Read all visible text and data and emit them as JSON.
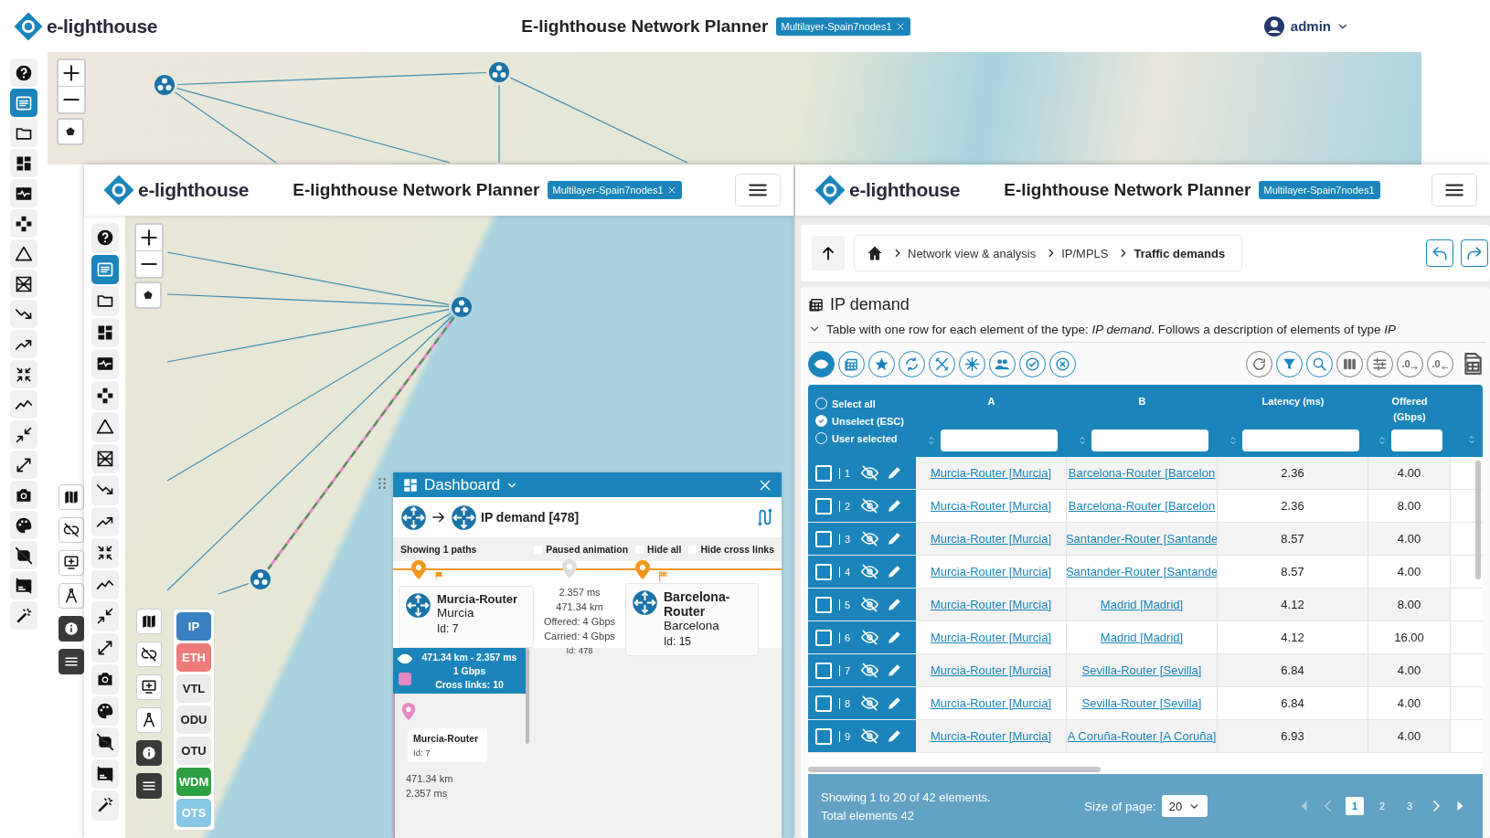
{
  "app_header": {
    "logo": "e-lighthouse",
    "title": "E-lighthouse Network Planner",
    "design_tag": "Multilayer-Spain7nodes1",
    "user": "admin"
  },
  "left_window": {
    "logo": "e-lighthouse",
    "title": "E-lighthouse Network Planner",
    "design_tag": "Multilayer-Spain7nodes1",
    "layers": [
      {
        "label": "IP",
        "color": "#3a7fc1"
      },
      {
        "label": "ETH",
        "color": "#ee7a7a"
      },
      {
        "label": "VTL",
        "color": "#ececec"
      },
      {
        "label": "ODU",
        "color": "#ececec"
      },
      {
        "label": "OTU",
        "color": "#ececec"
      },
      {
        "label": "WDM",
        "color": "#2ea043"
      },
      {
        "label": "OTS",
        "color": "#86c8e6"
      }
    ],
    "dashboard": {
      "title": "Dashboard",
      "demand": "IP demand [478]",
      "paths_count": "Showing 1 paths",
      "options": [
        {
          "label": "Paused animation",
          "checked": false
        },
        {
          "label": "Hide all",
          "checked": false
        },
        {
          "label": "Hide cross links",
          "checked": false
        }
      ],
      "origin": {
        "name": "Murcia-Router",
        "site": "Murcia",
        "id": "Id: 7"
      },
      "link_info": [
        "2.357 ms",
        "471.34 km",
        "Offered: 4 Gbps",
        "Carried: 4 Gbps",
        "Id: 478"
      ],
      "destination": {
        "name": "Barcelona-Router",
        "site": "Barcelona",
        "id": "Id: 15"
      },
      "path": {
        "selected": true,
        "color": "#e58ac6",
        "summary": [
          "471.34 km - 2.357 ms",
          "1 Gbps",
          "Cross links: 10"
        ],
        "node": {
          "name": "Murcia-Router",
          "id": "Id: 7"
        },
        "details": [
          "471.34 km",
          "2.357 ms"
        ]
      }
    }
  },
  "right_window": {
    "logo": "e-lighthouse",
    "title": "E-lighthouse Network Planner",
    "design_tag": "Multilayer-Spain7nodes1",
    "breadcrumb": [
      {
        "label": "Network view & analysis",
        "current": false
      },
      {
        "label": "IP/MPLS",
        "current": false
      },
      {
        "label": "Traffic demands",
        "current": true
      }
    ],
    "heading": "IP demand",
    "description": "Table with one row for each element of the type: *IP demand*. Follows a description of elements of type *IP*",
    "view_modes": [
      {
        "selected": true
      },
      {
        "selected": false
      },
      {
        "selected": false
      },
      {
        "selected": false
      },
      {
        "selected": false
      },
      {
        "selected": false
      },
      {
        "selected": false
      },
      {
        "selected": false
      },
      {
        "selected": false
      }
    ],
    "decimals_more": ".0",
    "decimals_less": ".0",
    "table": {
      "selection_options": [
        {
          "label": "Select all",
          "selected": false
        },
        {
          "label": "Unselect (ESC)",
          "selected": true
        },
        {
          "label": "User selected",
          "selected": false
        }
      ],
      "columns": [
        "A",
        "B",
        "Latency (ms)",
        "Offered (Gbps)"
      ],
      "rows": [
        {
          "number": "1",
          "checked": false,
          "a": "Murcia-Router [Murcia]",
          "b": "Barcelona-Router [Barcelon",
          "latency": "2.36",
          "offered": "4.00"
        },
        {
          "number": "2",
          "checked": false,
          "a": "Murcia-Router [Murcia]",
          "b": "Barcelona-Router [Barcelon",
          "latency": "2.36",
          "offered": "8.00"
        },
        {
          "number": "3",
          "checked": false,
          "a": "Murcia-Router [Murcia]",
          "b": "Santander-Router [Santande",
          "latency": "8.57",
          "offered": "4.00"
        },
        {
          "number": "4",
          "checked": false,
          "a": "Murcia-Router [Murcia]",
          "b": "Santander-Router [Santande",
          "latency": "8.57",
          "offered": "4.00"
        },
        {
          "number": "5",
          "checked": false,
          "a": "Murcia-Router [Murcia]",
          "b": "Madrid [Madrid]",
          "latency": "4.12",
          "offered": "8.00"
        },
        {
          "number": "6",
          "checked": false,
          "a": "Murcia-Router [Murcia]",
          "b": "Madrid [Madrid]",
          "latency": "4.12",
          "offered": "16.00"
        },
        {
          "number": "7",
          "checked": false,
          "a": "Murcia-Router [Murcia]",
          "b": "Sevilla-Router [Sevilla]",
          "latency": "6.84",
          "offered": "4.00"
        },
        {
          "number": "8",
          "checked": false,
          "a": "Murcia-Router [Murcia]",
          "b": "Sevilla-Router [Sevilla]",
          "latency": "6.84",
          "offered": "4.00"
        },
        {
          "number": "9",
          "checked": false,
          "a": "Murcia-Router [Murcia]",
          "b": "A Coruña-Router [A Coruña]",
          "latency": "6.93",
          "offered": "4.00"
        }
      ],
      "summary": "Showing 1 to 20 of 42 elements.",
      "total": "Total elements 42",
      "page_size_label": "Size of page:",
      "page_size": "20",
      "pages": [
        {
          "label": "1",
          "selected": true
        },
        {
          "label": "2",
          "selected": false
        },
        {
          "label": "3",
          "selected": false
        }
      ]
    }
  }
}
